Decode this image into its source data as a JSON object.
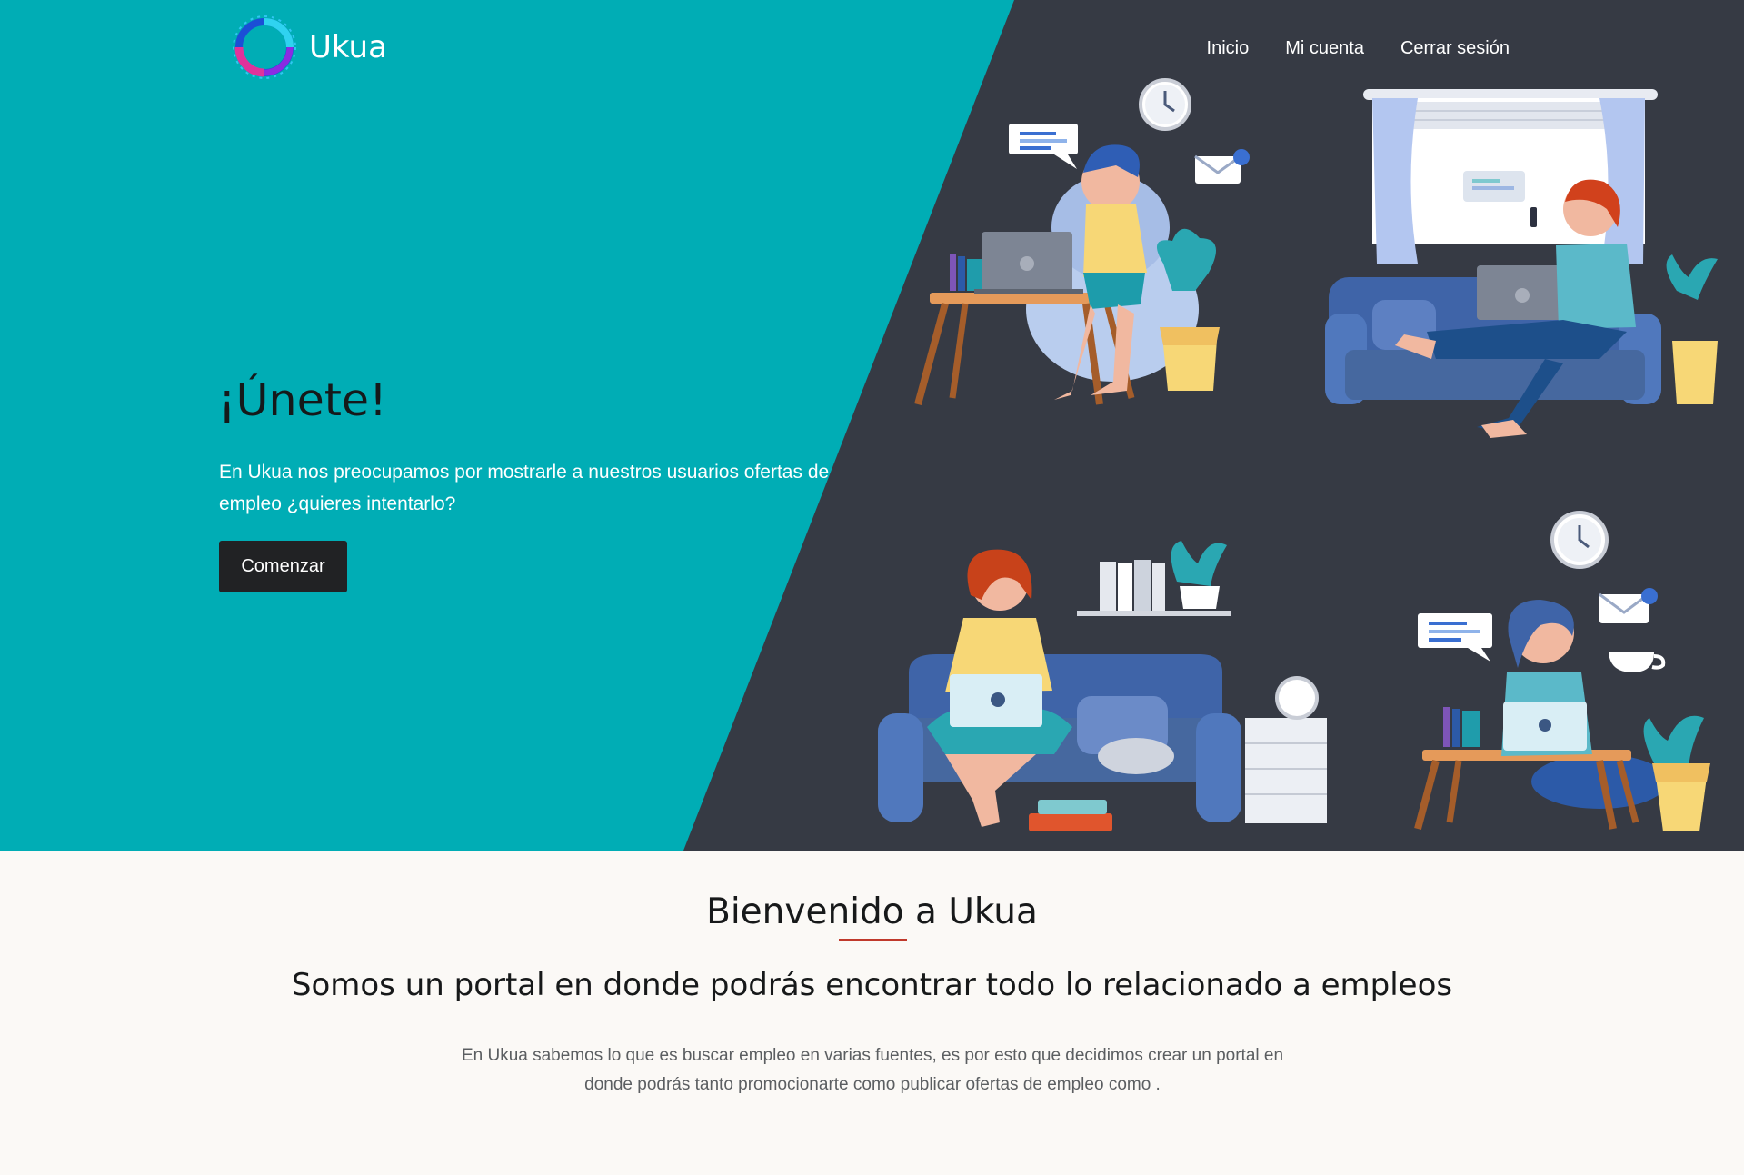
{
  "brand": {
    "name": "Ukua",
    "logo_icon": "ring-logo-icon",
    "colors": {
      "teal": "#00adb5",
      "dark": "#363a44",
      "button": "#212224",
      "accent_underline": "#c0392b"
    }
  },
  "nav": {
    "items": [
      {
        "label": "Inicio"
      },
      {
        "label": "Mi cuenta"
      },
      {
        "label": "Cerrar sesión"
      }
    ]
  },
  "hero": {
    "title": "¡Únete!",
    "text": "En Ukua nos preocupamos por mostrarle a nuestros usuarios ofertas de empleo ¿quieres intentarlo?",
    "button_label": "Comenzar",
    "illustration_icon": "remote-work-illustration"
  },
  "about": {
    "title": "Bienvenido a Ukua",
    "subtitle": "Somos un portal en donde podrás encontrar todo lo relacionado a empleos",
    "text": "En Ukua sabemos lo que es buscar empleo en varias fuentes, es por esto que decidimos crear un portal en donde podrás tanto promocionarte como publicar ofertas de empleo como ."
  }
}
